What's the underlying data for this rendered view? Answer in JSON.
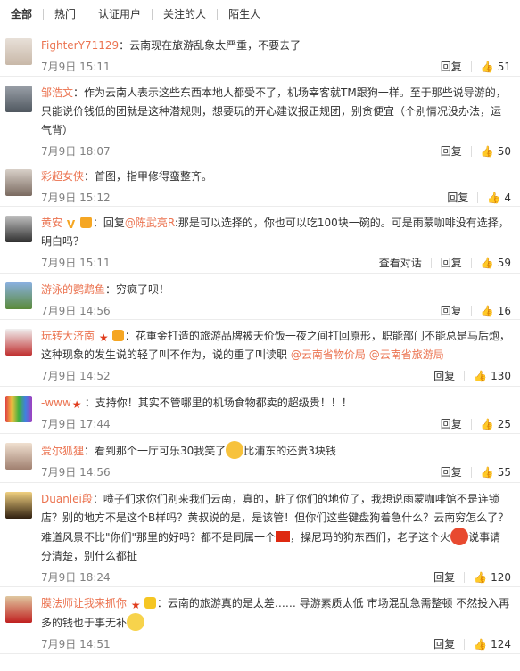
{
  "tabs": [
    "全部",
    "热门",
    "认证用户",
    "关注的人",
    "陌生人"
  ],
  "actions": {
    "reply": "回复",
    "view_thread": "查看对话"
  },
  "comments": [
    {
      "user": "FighterY71129",
      "text": "：云南现在旅游乱象太严重，不要去了",
      "time": "7月9日 15:11",
      "likes": "51"
    },
    {
      "user": "邹浩文",
      "text": "：作为云南人表示这些东西本地人都受不了，机场宰客就TM跟狗一样。至于那些说导游的，只能说价钱低的团就是这种潜规则，想要玩的开心建议报正规团，别贪便宜（个别情况没办法，运气背）",
      "time": "7月9日 18:07",
      "likes": "50"
    },
    {
      "user": "彩超女侠",
      "text": "：首图，指甲修得蛮整齐。",
      "time": "7月9日 15:12",
      "likes": "4"
    },
    {
      "user": "黄安",
      "text_pre": "：回复",
      "mention": "@陈武亮R",
      "text": ":那是可以选择的，你也可以吃100块一碗的。可是雨蒙咖啡没有选择，明白吗？",
      "time": "7月9日 15:11",
      "likes": "59"
    },
    {
      "user": "游泳的鹦鹉鱼",
      "text": "：穷疯了呗！",
      "time": "7月9日 14:56",
      "likes": "16"
    },
    {
      "user": "玩转大济南",
      "text": "：花重金打造的旅游品牌被天价饭一夜之间打回原形，职能部门不能总是马后炮，这种现象的发生说的轻了叫不作为，说的重了叫读职",
      "mention1": "@云南省物价局",
      "mention2": "@云南省旅游局",
      "time": "7月9日 14:52",
      "likes": "130"
    },
    {
      "user": "-www",
      "text": "：支持你！其实不管哪里的机场食物都卖的超级贵！！！",
      "time": "7月9日 17:44",
      "likes": "25"
    },
    {
      "user": "爱尔狐狸",
      "text": "：看到那个一厅可乐30我笑了",
      "text_post": "比浦东的还贵3块钱",
      "time": "7月9日 14:56",
      "likes": "55"
    },
    {
      "user": "Duanlei段",
      "text": "：喷子们求你们别来我们云南，真的，脏了你们的地位了，我想说雨蒙咖啡馆不是连锁店？别的地方不是这个B样吗？黄叔说的是，是该管！但你们这些键盘狗着急什么？云南穷怎么了？难道风景不比\"你们\"那里的好吗？都不是同属一个",
      "text_mid": "，操尼玛的狗东西们，老子这个火",
      "text_post": "说事请分清楚，别什么都扯",
      "time": "7月9日 18:24",
      "likes": "120"
    },
    {
      "user": "膜法师让我来抓你",
      "text": "：云南的旅游真的是太差……  导游素质太低  市场混乱急需整顿  不然投入再多的钱也于事无补",
      "time": "7月9日 14:51",
      "likes": "124"
    }
  ],
  "colors": {
    "link": "#eb7350",
    "meta": "#808080"
  }
}
